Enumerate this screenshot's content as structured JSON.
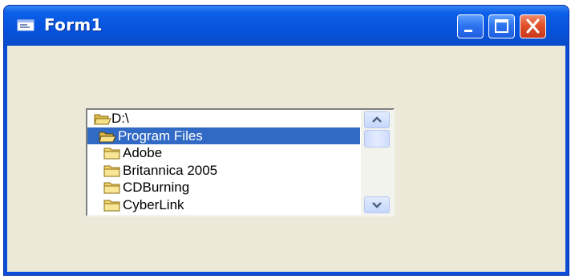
{
  "window": {
    "title": "Form1",
    "icon": "form-icon",
    "buttons": {
      "minimize": "minimize-icon",
      "maximize": "maximize-icon",
      "close": "close-icon"
    }
  },
  "dir_list": {
    "items": [
      {
        "label": "D:\\",
        "icon": "open-folder-icon",
        "indent": 0,
        "selected": false
      },
      {
        "label": "Program Files",
        "icon": "open-folder-icon",
        "indent": 1,
        "selected": true
      },
      {
        "label": "Adobe",
        "icon": "folder-icon",
        "indent": 2,
        "selected": false
      },
      {
        "label": "Britannica 2005",
        "icon": "folder-icon",
        "indent": 2,
        "selected": false
      },
      {
        "label": "CDBurning",
        "icon": "folder-icon",
        "indent": 2,
        "selected": false
      },
      {
        "label": "CyberLink",
        "icon": "folder-icon",
        "indent": 2,
        "selected": false
      }
    ],
    "scroll_position": 0
  },
  "colors": {
    "titlebar": "#0752dc",
    "form_background": "#ece9d8",
    "selection": "#316ac5",
    "close_button": "#e1512a"
  }
}
